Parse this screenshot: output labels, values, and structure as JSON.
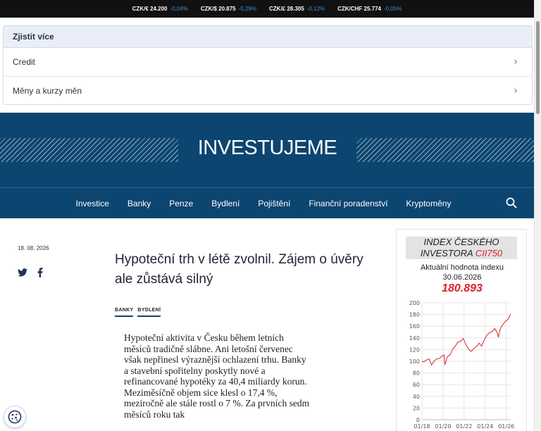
{
  "ticker": [
    {
      "pair": "CZK/€ 24.200",
      "change": "-0,04%"
    },
    {
      "pair": "CZK/$ 20.875",
      "change": "-0,29%"
    },
    {
      "pair": "CZK/£ 28.305",
      "change": "-0,12%"
    },
    {
      "pair": "CZK/CHF 25.774",
      "change": "-0,05%"
    }
  ],
  "learn_more": {
    "title": "Zjistit více",
    "items": [
      "Credit",
      "Měny a kurzy měn"
    ]
  },
  "brand": {
    "logo": "INVESTUJEME"
  },
  "nav": [
    "Investice",
    "Banky",
    "Penze",
    "Bydlení",
    "Pojištění",
    "Finanční poradenství",
    "Kryptoměny"
  ],
  "article": {
    "date": "18. 08. 2026",
    "title": "Hypoteční trh v létě zvolnil. Zájem o úvěry ale zůstává silný",
    "tags": [
      "BANKY",
      "BYDLENÍ"
    ],
    "body": "Hypoteční aktivita v Česku během letních měsíců tradičně slábne. Ani letošní červenec však nepřinesl výraznější ochlazení trhu. Banky a stavební spořitelny poskytly nové a refinancované hypotéky za 40,4 miliardy korun. Meziměsíčně objem sice klesl o 17,4 %, meziročně ale stále rostl o 7 %. Za prvních sedm měsíců roku tak"
  },
  "index": {
    "head_line1": "INDEX ČESKÉHO",
    "head_line2": "INVESTORA",
    "code": "CII750",
    "subtitle": "Aktuální hodnota indexu",
    "date": "30.06.2026",
    "value": "180.893"
  },
  "colors": {
    "brand": "#0c4570",
    "accent_red": "#d8232a",
    "ticker_change": "#3d8fd6"
  },
  "chart_data": {
    "type": "line",
    "title": "",
    "xlabel": "",
    "ylabel": "",
    "x_tick_labels": [
      "01/18",
      "01/20",
      "01/22",
      "01/24",
      "01/26"
    ],
    "y_ticks": [
      0,
      20,
      40,
      60,
      80,
      100,
      120,
      140,
      160,
      180,
      200
    ],
    "ylim": [
      0,
      200
    ],
    "xlim": [
      "2018-01",
      "2026-06"
    ],
    "grid": true,
    "series": [
      {
        "color": "#d8232a",
        "points": [
          [
            "2018-01",
            100
          ],
          [
            "2018-03",
            99
          ],
          [
            "2018-06",
            102
          ],
          [
            "2018-09",
            104
          ],
          [
            "2018-12",
            94
          ],
          [
            "2019-03",
            101
          ],
          [
            "2019-06",
            104
          ],
          [
            "2019-09",
            105
          ],
          [
            "2019-12",
            109
          ],
          [
            "2020-02",
            111
          ],
          [
            "2020-03",
            94
          ],
          [
            "2020-06",
            108
          ],
          [
            "2020-09",
            111
          ],
          [
            "2020-12",
            121
          ],
          [
            "2021-03",
            126
          ],
          [
            "2021-06",
            133
          ],
          [
            "2021-09",
            134
          ],
          [
            "2021-12",
            139
          ],
          [
            "2022-03",
            129
          ],
          [
            "2022-06",
            121
          ],
          [
            "2022-09",
            117
          ],
          [
            "2022-12",
            122
          ],
          [
            "2023-03",
            125
          ],
          [
            "2023-06",
            131
          ],
          [
            "2023-09",
            126
          ],
          [
            "2023-12",
            137
          ],
          [
            "2024-03",
            145
          ],
          [
            "2024-06",
            149
          ],
          [
            "2024-09",
            151
          ],
          [
            "2024-12",
            156
          ],
          [
            "2025-03",
            148
          ],
          [
            "2025-04",
            141
          ],
          [
            "2025-06",
            155
          ],
          [
            "2025-09",
            163
          ],
          [
            "2025-12",
            168
          ],
          [
            "2026-03",
            172
          ],
          [
            "2026-06",
            181
          ]
        ]
      }
    ]
  }
}
